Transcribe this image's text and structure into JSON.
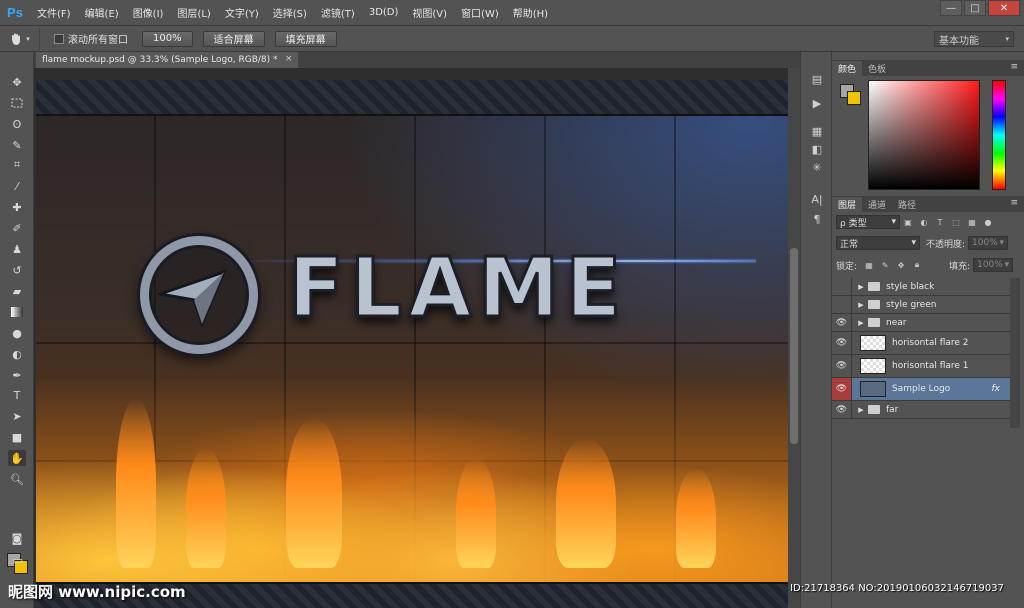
{
  "app": {
    "logo": "Ps"
  },
  "menu": [
    "文件(F)",
    "编辑(E)",
    "图像(I)",
    "图层(L)",
    "文字(Y)",
    "选择(S)",
    "滤镜(T)",
    "3D(D)",
    "视图(V)",
    "窗口(W)",
    "帮助(H)"
  ],
  "window_controls": {
    "minimize": "—",
    "maximize": "□",
    "close": "✕"
  },
  "options": {
    "scroll_all_label": "滚动所有窗口",
    "zoom_100": "100%",
    "fit_screen": "适合屏幕",
    "fill_screen": "填充屏幕",
    "workspace": "基本功能"
  },
  "document": {
    "tab_title": "flame mockup.psd @ 33.3% (Sample Logo, RGB/8) *",
    "close": "×"
  },
  "canvas": {
    "logo_text": "FLAME"
  },
  "panels": {
    "color_tabs": [
      "颜色",
      "色板"
    ],
    "layer_tabs": [
      "图层",
      "通道",
      "路径"
    ],
    "filter_kind": "ρ 类型",
    "blend_mode": "正常",
    "opacity_label": "不透明度:",
    "opacity_value": "100%",
    "lock_label": "锁定:",
    "fill_label": "填充:",
    "fill_value": "100%"
  },
  "layers": [
    {
      "name": "style black",
      "type": "folder",
      "visible": false
    },
    {
      "name": "style green",
      "type": "folder",
      "visible": false
    },
    {
      "name": "near",
      "type": "folder",
      "visible": true
    },
    {
      "name": "horisontal flare 2",
      "type": "layer",
      "visible": true
    },
    {
      "name": "horisontal flare 1",
      "type": "layer",
      "visible": true
    },
    {
      "name": "Sample Logo",
      "type": "layer",
      "visible": true,
      "selected": true,
      "fx": "fx"
    },
    {
      "name": "far",
      "type": "folder",
      "visible": true
    }
  ],
  "watermark": {
    "left": "昵图网 www.nipic.com",
    "right": "ID:21718364 NO:20190106032146719037"
  },
  "colors": {
    "accent": "#31a8ff",
    "selected_layer": "#5b7698",
    "foreground": "#a6a6a6",
    "background": "#f0c300"
  }
}
